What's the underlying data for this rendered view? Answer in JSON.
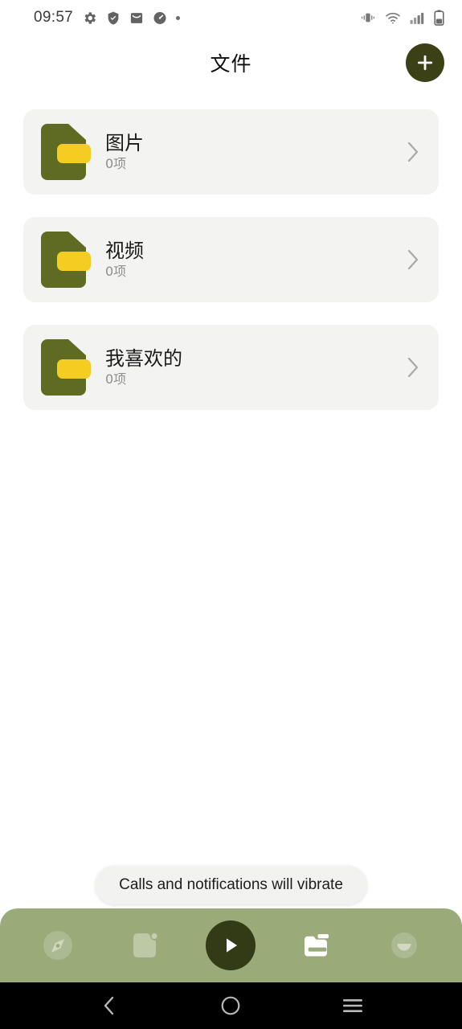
{
  "statusbar": {
    "time": "09:57",
    "left_icons": [
      "gear-icon",
      "shield-check-icon",
      "mail-icon",
      "speedometer-icon",
      "dot-icon"
    ],
    "right_icons": [
      "vibrate-icon",
      "wifi-icon",
      "signal-bars-icon",
      "battery-icon"
    ]
  },
  "header": {
    "title": "文件",
    "add_button_label": "+",
    "accent_dark": "#3b4016"
  },
  "folders": [
    {
      "name": "图片",
      "count": "0项",
      "icon": "folder-icon",
      "chevron": "chevron-right-icon"
    },
    {
      "name": "视频",
      "count": "0项",
      "icon": "folder-icon",
      "chevron": "chevron-right-icon"
    },
    {
      "name": "我喜欢的",
      "count": "0项",
      "icon": "folder-icon",
      "chevron": "chevron-right-icon"
    }
  ],
  "toast": {
    "message": "Calls and notifications will vibrate"
  },
  "dock": {
    "background": "#9aab79",
    "items": [
      {
        "icon": "compass-icon",
        "active": false
      },
      {
        "icon": "document-badge-icon",
        "active": false
      },
      {
        "icon": "play-icon",
        "active": false
      },
      {
        "icon": "folder-icon",
        "active": true
      },
      {
        "icon": "account-circle-icon",
        "active": false
      }
    ]
  },
  "androidnav": {
    "items": [
      {
        "icon": "back-icon"
      },
      {
        "icon": "home-icon"
      },
      {
        "icon": "recents-icon"
      }
    ]
  },
  "colors": {
    "folder_green": "#5f6b22",
    "folder_yellow": "#f5cc22",
    "card_bg": "#f3f4f1",
    "dock_bg": "#9aab79",
    "accent_dark": "#3b4016"
  }
}
